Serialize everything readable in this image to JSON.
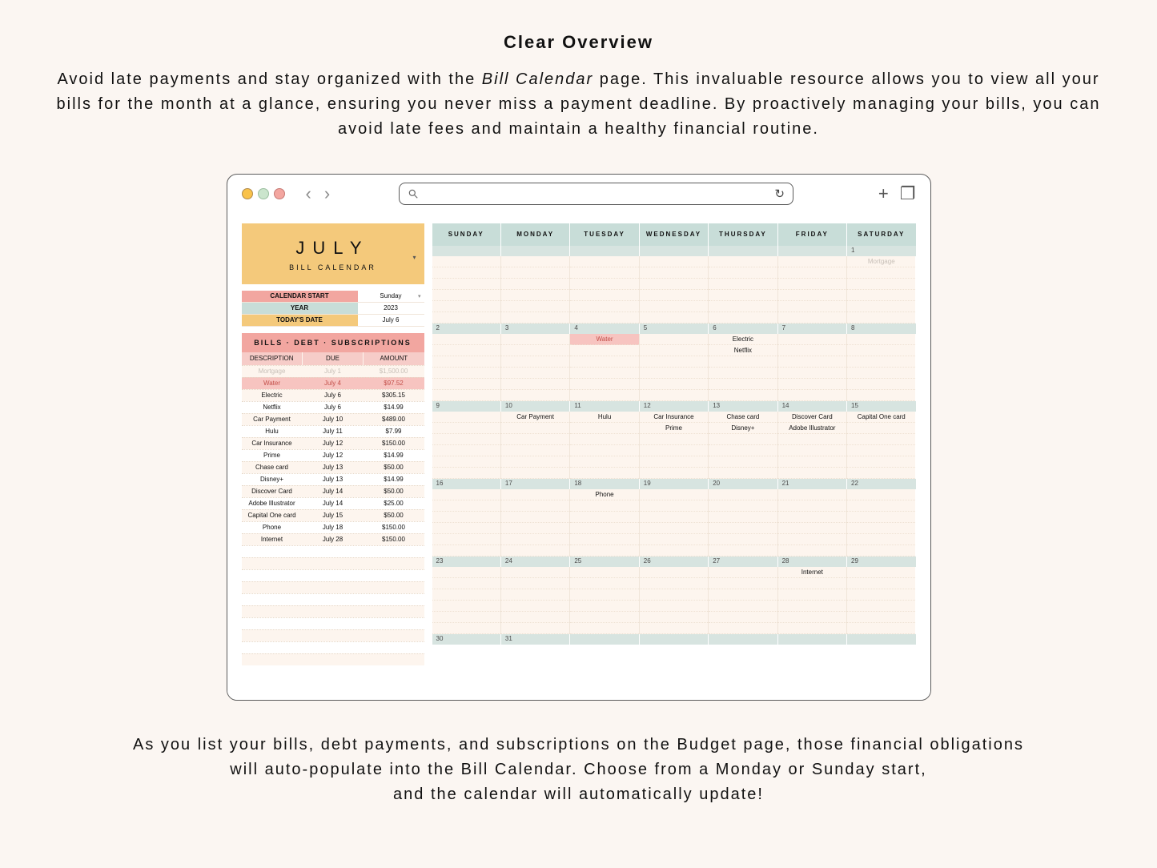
{
  "heading": "Clear Overview",
  "intro_a": "Avoid late payments and stay organized with the ",
  "intro_em": "Bill Calendar",
  "intro_b": " page. This invaluable resource allows you to view all your bills for the month at a glance, ensuring you never miss a payment deadline. By proactively managing your bills, you can avoid late fees and maintain a healthy financial routine.",
  "outro_1": "As you list your bills, debt payments, and subscriptions on the Budget page, those financial obligations",
  "outro_2": "will auto-populate into the Bill Calendar. Choose from a Monday or Sunday start,",
  "outro_3": "and the calendar will automatically update!",
  "month": {
    "name": "JULY",
    "sub": "BILL CALENDAR"
  },
  "settings": {
    "start_label": "CALENDAR START",
    "start_value": "Sunday",
    "year_label": "YEAR",
    "year_value": "2023",
    "today_label": "TODAY'S DATE",
    "today_value": "July 6"
  },
  "bills_header": "BILLS · DEBT · SUBSCRIPTIONS",
  "bills_cols": {
    "c1": "DESCRIPTION",
    "c2": "DUE",
    "c3": "AMOUNT"
  },
  "bills": [
    {
      "d": "Mortgage",
      "due": "July 1",
      "amt": "$1,500.00",
      "dim": true
    },
    {
      "d": "Water",
      "due": "July 4",
      "amt": "$97.52",
      "red": true
    },
    {
      "d": "Electric",
      "due": "July 6",
      "amt": "$305.15"
    },
    {
      "d": "Netflix",
      "due": "July 6",
      "amt": "$14.99"
    },
    {
      "d": "Car Payment",
      "due": "July 10",
      "amt": "$489.00"
    },
    {
      "d": "Hulu",
      "due": "July 11",
      "amt": "$7.99"
    },
    {
      "d": "Car Insurance",
      "due": "July 12",
      "amt": "$150.00"
    },
    {
      "d": "Prime",
      "due": "July 12",
      "amt": "$14.99"
    },
    {
      "d": "Chase card",
      "due": "July 13",
      "amt": "$50.00"
    },
    {
      "d": "Disney+",
      "due": "July 13",
      "amt": "$14.99"
    },
    {
      "d": "Discover Card",
      "due": "July 14",
      "amt": "$50.00"
    },
    {
      "d": "Adobe Illustrator",
      "due": "July 14",
      "amt": "$25.00"
    },
    {
      "d": "Capital One card",
      "due": "July 15",
      "amt": "$50.00"
    },
    {
      "d": "Phone",
      "due": "July 18",
      "amt": "$150.00"
    },
    {
      "d": "Internet",
      "due": "July 28",
      "amt": "$150.00"
    }
  ],
  "days": {
    "d0": "SUNDAY",
    "d1": "MONDAY",
    "d2": "TUESDAY",
    "d3": "WEDNESDAY",
    "d4": "THURSDAY",
    "d5": "FRIDAY",
    "d6": "SATURDAY"
  },
  "weeks": [
    {
      "dates": [
        "",
        "",
        "",
        "",
        "",
        "",
        "1"
      ],
      "rows": 6,
      "cells": [
        [],
        [],
        [],
        [],
        [],
        [],
        [
          {
            "t": "Mortgage",
            "dim": true
          }
        ]
      ]
    },
    {
      "dates": [
        "2",
        "3",
        "4",
        "5",
        "6",
        "7",
        "8"
      ],
      "rows": 6,
      "cells": [
        [],
        [],
        [
          {
            "t": "Water",
            "water": true
          }
        ],
        [],
        [
          {
            "t": "Electric"
          },
          {
            "t": "Netflix"
          }
        ],
        [],
        []
      ]
    },
    {
      "dates": [
        "9",
        "10",
        "11",
        "12",
        "13",
        "14",
        "15"
      ],
      "rows": 6,
      "cells": [
        [],
        [
          {
            "t": "Car Payment"
          }
        ],
        [
          {
            "t": "Hulu"
          }
        ],
        [
          {
            "t": "Car Insurance"
          },
          {
            "t": "Prime"
          }
        ],
        [
          {
            "t": "Chase card"
          },
          {
            "t": "Disney+"
          }
        ],
        [
          {
            "t": "Discover Card"
          },
          {
            "t": "Adobe Illustrator"
          }
        ],
        [
          {
            "t": "Capital One card"
          }
        ]
      ]
    },
    {
      "dates": [
        "16",
        "17",
        "18",
        "19",
        "20",
        "21",
        "22"
      ],
      "rows": 6,
      "cells": [
        [],
        [],
        [
          {
            "t": "Phone"
          }
        ],
        [],
        [],
        [],
        []
      ]
    },
    {
      "dates": [
        "23",
        "24",
        "25",
        "26",
        "27",
        "28",
        "29"
      ],
      "rows": 6,
      "cells": [
        [],
        [],
        [],
        [],
        [],
        [
          {
            "t": "Internet"
          }
        ],
        []
      ]
    },
    {
      "dates": [
        "30",
        "31",
        "",
        "",
        "",
        "",
        ""
      ],
      "rows": 0,
      "cells": [
        [],
        [],
        [],
        [],
        [],
        [],
        []
      ]
    }
  ]
}
